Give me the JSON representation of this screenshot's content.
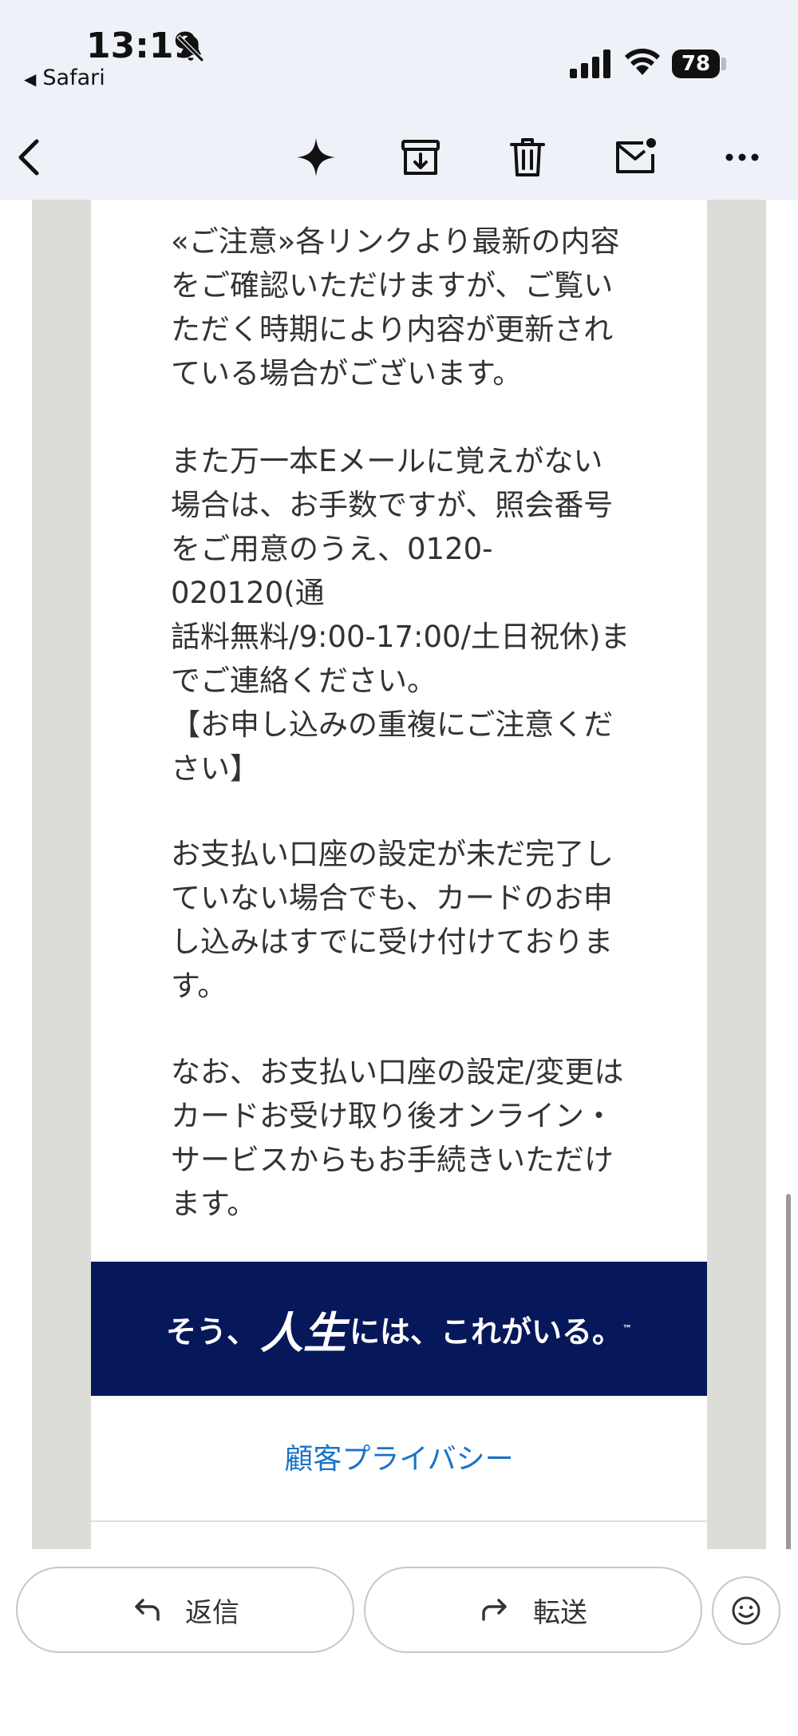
{
  "status_bar": {
    "time": "13:19",
    "back_app": "Safari",
    "battery": "78"
  },
  "toolbar": {
    "icons": [
      "back-icon",
      "sparkle-icon",
      "archive-icon",
      "trash-icon",
      "mark-unread-icon",
      "more-icon"
    ]
  },
  "email": {
    "paragraphs": [
      "«ご注意»各リンクより最新の内容\nをご確認いただけますが、ご覧い\nただく時期により内容が更新され\nている場合がございます。",
      "また万一本Eメールに覚えがない\n場合は、お手数ですが、照会番号\nをご用意のうえ、0120-020120(通\n話料無料/9:00-17:00/土日祝休)ま\nでご連絡ください。",
      "【お申し込みの重複にご注意くだ\nさい】",
      "お支払い口座の設定が未だ完了し\nていない場合でも、カードのお申\nし込みはすでに受け付けておりま\nす。",
      "なお、お支払い口座の設定/変更は\nカードお受け取り後オンライン・\nサービスからもお手続きいただけ\nます。"
    ],
    "banner": {
      "pre": "そう、",
      "big": "人生",
      "post": "には、これがいる。",
      "tm": "™"
    },
    "privacy_link": "顧客プライバシー"
  },
  "bottom_bar": {
    "reply_label": "返信",
    "forward_label": "転送"
  },
  "colors": {
    "banner_bg": "#06185a",
    "link": "#1a73c8",
    "gutter": "#dcdcd8",
    "chrome_bg": "#eef1f7"
  }
}
